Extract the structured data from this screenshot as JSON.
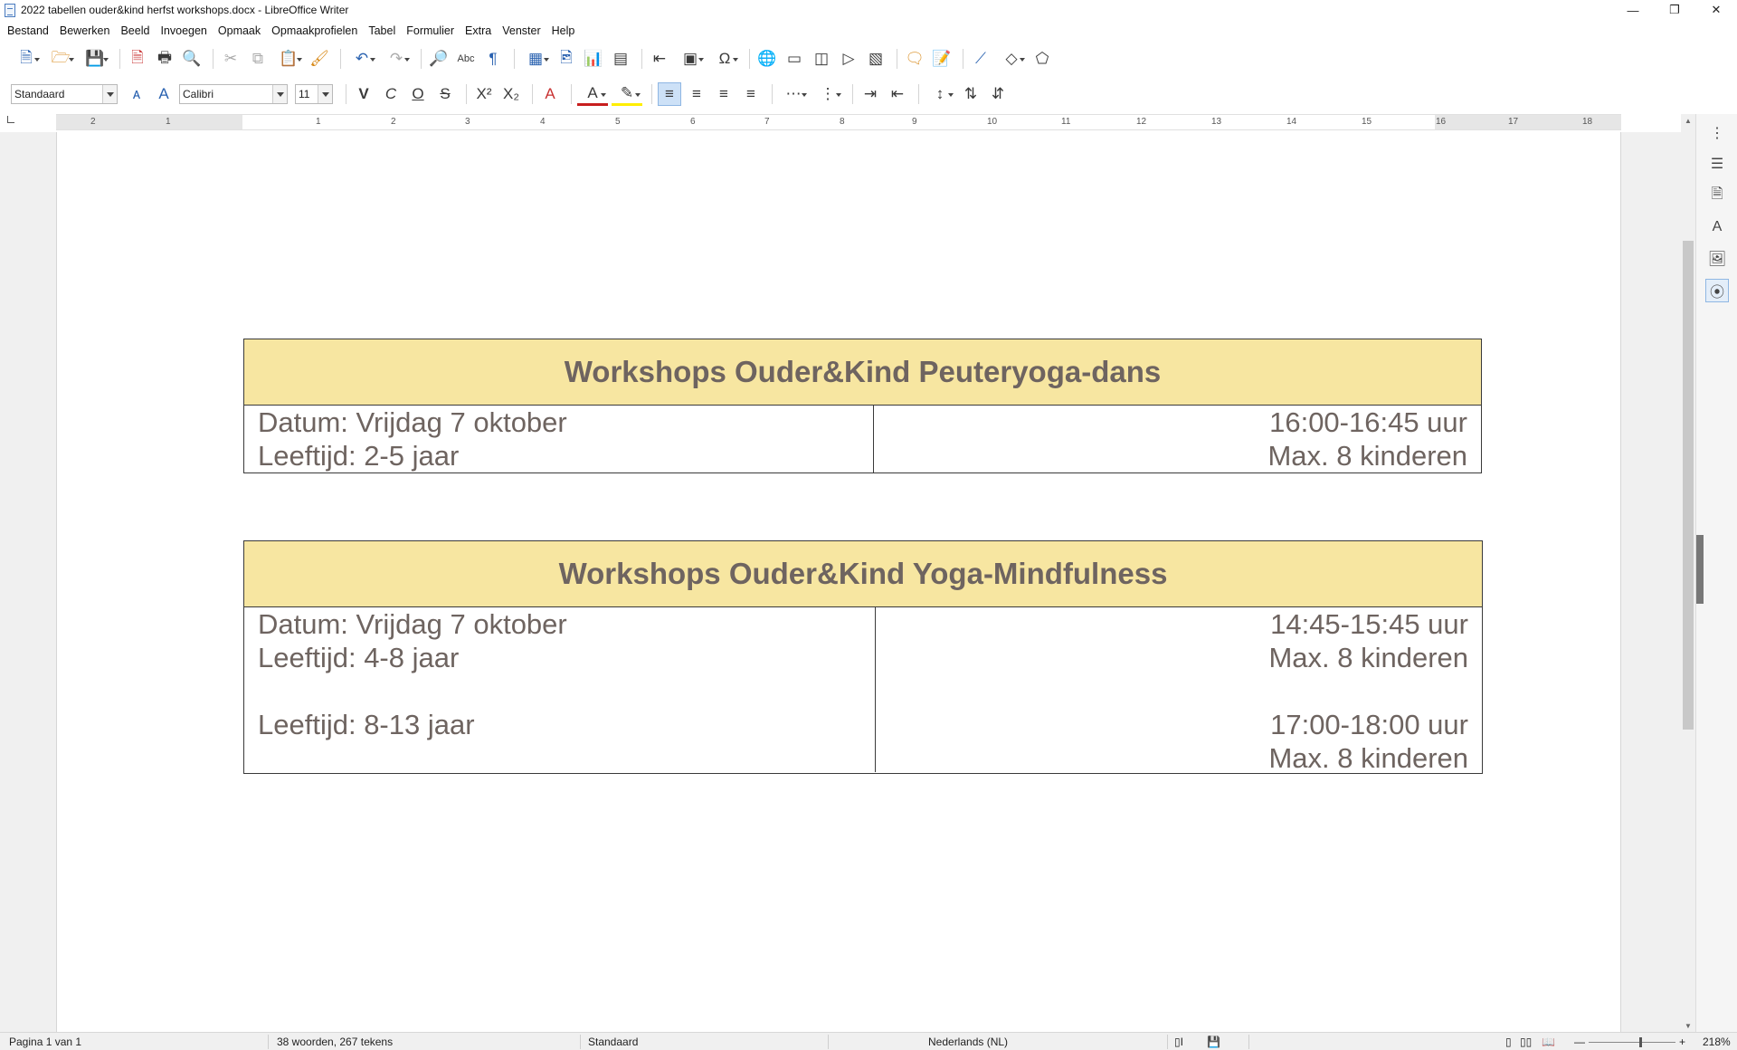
{
  "window": {
    "title": "2022 tabellen ouder&kind herfst workshops.docx - LibreOffice Writer",
    "controls": [
      "minimize-icon",
      "restore-icon",
      "close-icon"
    ]
  },
  "menu": [
    {
      "label": "Bestand"
    },
    {
      "label": "Bewerken"
    },
    {
      "label": "Beeld"
    },
    {
      "label": "Invoegen"
    },
    {
      "label": "Opmaak"
    },
    {
      "label": "Opmaakprofielen"
    },
    {
      "label": "Tabel"
    },
    {
      "label": "Formulier"
    },
    {
      "label": "Extra"
    },
    {
      "label": "Venster"
    },
    {
      "label": "Help"
    }
  ],
  "formatting": {
    "paragraph_style": "Standaard",
    "font_name": "Calibri",
    "font_size": "11",
    "bold_glyph": "V",
    "italic_glyph": "C",
    "underline_glyph": "O",
    "strike_glyph": "S"
  },
  "ruler": {
    "numbers": [
      "2",
      "1",
      "1",
      "2",
      "3",
      "4",
      "5",
      "6",
      "7",
      "8",
      "9",
      "10",
      "11",
      "12",
      "13",
      "14",
      "15",
      "16",
      "17",
      "18"
    ]
  },
  "document": {
    "tables": [
      {
        "title": "Workshops Ouder&Kind Peuteryoga-dans",
        "left_lines": [
          "Datum: Vrijdag 7 oktober",
          "Leeftijd: 2-5 jaar"
        ],
        "right_lines": [
          "16:00-16:45 uur",
          "Max. 8 kinderen"
        ]
      },
      {
        "title": "Workshops Ouder&Kind Yoga-Mindfulness",
        "left_lines": [
          "Datum: Vrijdag 7 oktober",
          "Leeftijd: 4-8 jaar",
          "",
          "Leeftijd: 8-13 jaar",
          ""
        ],
        "right_lines": [
          "14:45-15:45 uur",
          "Max. 8 kinderen",
          "",
          "17:00-18:00 uur",
          "Max. 8 kinderen"
        ]
      }
    ],
    "colors": {
      "header_fill": "#f7e6a1",
      "text": "#6e6460",
      "border": "#3a3a3a"
    }
  },
  "status": {
    "page": "Pagina 1 van 1",
    "words": "38 woorden, 267 tekens",
    "style": "Standaard",
    "language": "Nederlands (NL)",
    "zoom": "218%"
  }
}
